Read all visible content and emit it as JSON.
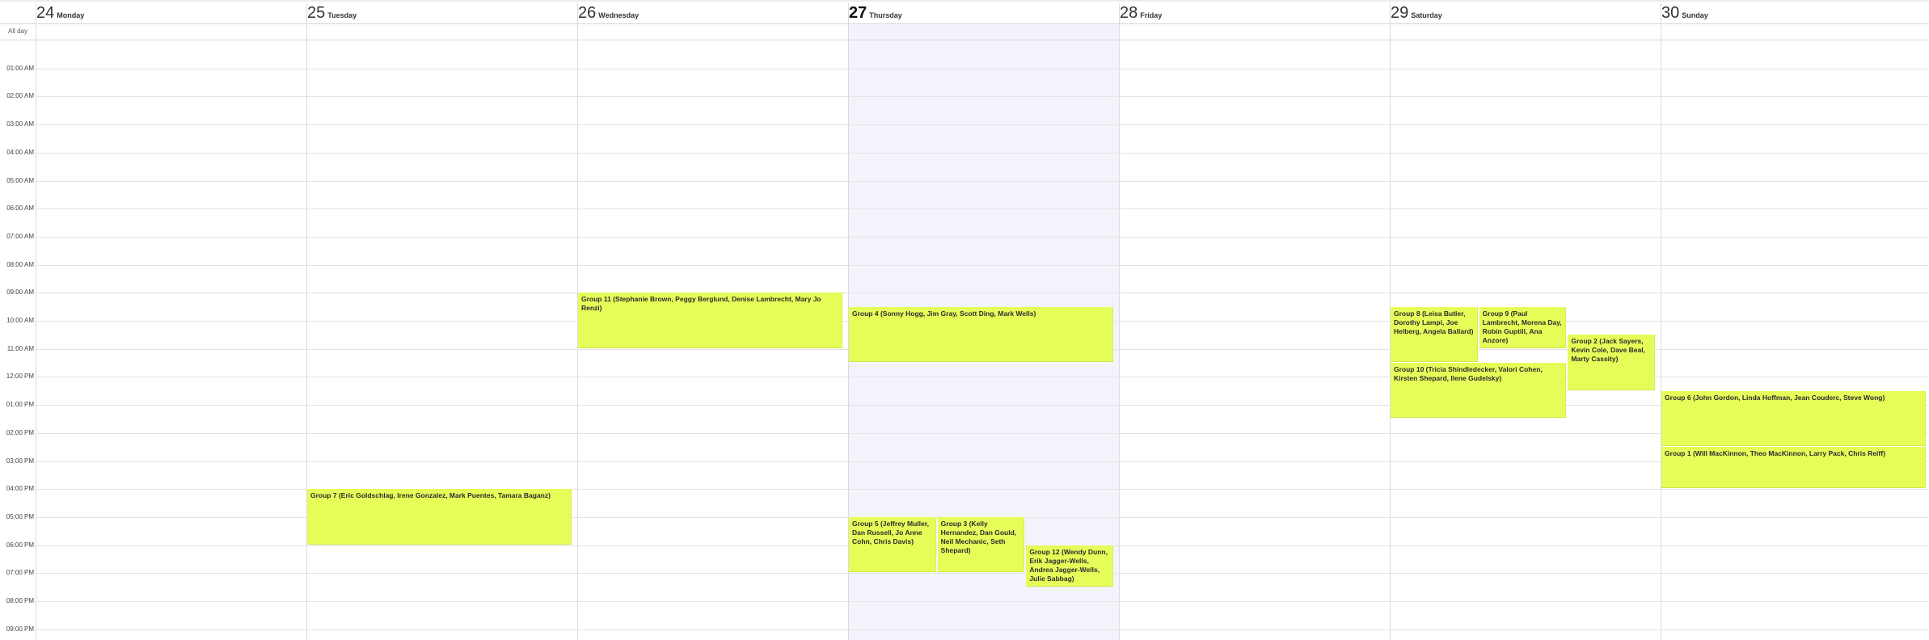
{
  "calendar": {
    "all_day_label": "All day",
    "days": [
      {
        "number": "24",
        "name": "Monday",
        "today": false
      },
      {
        "number": "25",
        "name": "Tuesday",
        "today": false
      },
      {
        "number": "26",
        "name": "Wednesday",
        "today": false
      },
      {
        "number": "27",
        "name": "Thursday",
        "today": true
      },
      {
        "number": "28",
        "name": "Friday",
        "today": false
      },
      {
        "number": "29",
        "name": "Saturday",
        "today": false
      },
      {
        "number": "30",
        "name": "Sunday",
        "today": false
      }
    ],
    "time_labels": [
      "01:00 AM",
      "02:00 AM",
      "03:00 AM",
      "04:00 AM",
      "05:00 AM",
      "06:00 AM",
      "07:00 AM",
      "08:00 AM",
      "09:00 AM",
      "10:00 AM",
      "11:00 AM",
      "12:00 PM",
      "01:00 PM",
      "02:00 PM",
      "03:00 PM",
      "04:00 PM",
      "05:00 PM",
      "06:00 PM",
      "07:00 PM",
      "08:00 PM",
      "09:00 PM"
    ],
    "events": [
      {
        "title": "Group 11 (Stephanie Brown, Peggy Berglund, Denise Lambrecht, Mary Jo Renzi)",
        "day": 2,
        "start": "09:00",
        "end": "11:00",
        "column": 0,
        "columns": 1
      },
      {
        "title": "Group 4 (Sonny Hogg, Jim Gray, Scott Ding, Mark Wells)",
        "day": 3,
        "start": "09:30",
        "end": "11:30",
        "column": 0,
        "columns": 1
      },
      {
        "title": "Group 7 (Eric Goldschlag, Irene Gonzalez, Mark Puentes, Tamara Baganz)",
        "day": 1,
        "start": "16:00",
        "end": "18:00",
        "column": 0,
        "columns": 1
      },
      {
        "title": "Group 5 (Jeffrey Muller, Dan Russell, Jo Anne Cohn, Chris Davis)",
        "day": 3,
        "start": "17:00",
        "end": "19:00",
        "column": 0,
        "columns": 3
      },
      {
        "title": "Group 3 (Kelly Hernandez, Dan Gould, Neil Mechanic, Seth Shepard)",
        "day": 3,
        "start": "17:00",
        "end": "19:00",
        "column": 1,
        "columns": 3
      },
      {
        "title": "Group 12 (Wendy Dunn, Erik Jagger-Wells, Andrea Jagger-Wells, Julie Sabbag)",
        "day": 3,
        "start": "18:00",
        "end": "19:30",
        "column": 2,
        "columns": 3
      },
      {
        "title": "Group 8 (Leisa Butler, Dorothy Lampi, Joe Helberg, Angela Ballard)",
        "day": 5,
        "start": "09:30",
        "end": "11:30",
        "column": 0,
        "columns": 3
      },
      {
        "title": "Group 9 (Paul Lambrecht, Morena Day, Robin Guptill, Ana Anzore)",
        "day": 5,
        "start": "09:30",
        "end": "11:00",
        "column": 1,
        "columns": 3
      },
      {
        "title": "Group 2 (Jack Sayers, Kevin Cole, Dave Beal, Marty Cassity)",
        "day": 5,
        "start": "10:30",
        "end": "12:30",
        "column": 2,
        "columns": 3
      },
      {
        "title": "Group 10 (Tricia Shindledecker, Valori Cohen, Kirsten Shepard, Ilene Gudelsky)",
        "day": 5,
        "start": "11:30",
        "end": "13:30",
        "column": 0,
        "columns": 3,
        "span": 2
      },
      {
        "title": "Group 6 (John Gordon, Linda Hoffman, Jean Couderc, Steve Wong)",
        "day": 6,
        "start": "12:30",
        "end": "14:30",
        "column": 0,
        "columns": 1
      },
      {
        "title": "Group 1 (Will MacKinnon, Theo MacKinnon, Larry Pack, Chris Reiff)",
        "day": 6,
        "start": "14:30",
        "end": "16:00",
        "column": 0,
        "columns": 1
      }
    ]
  }
}
